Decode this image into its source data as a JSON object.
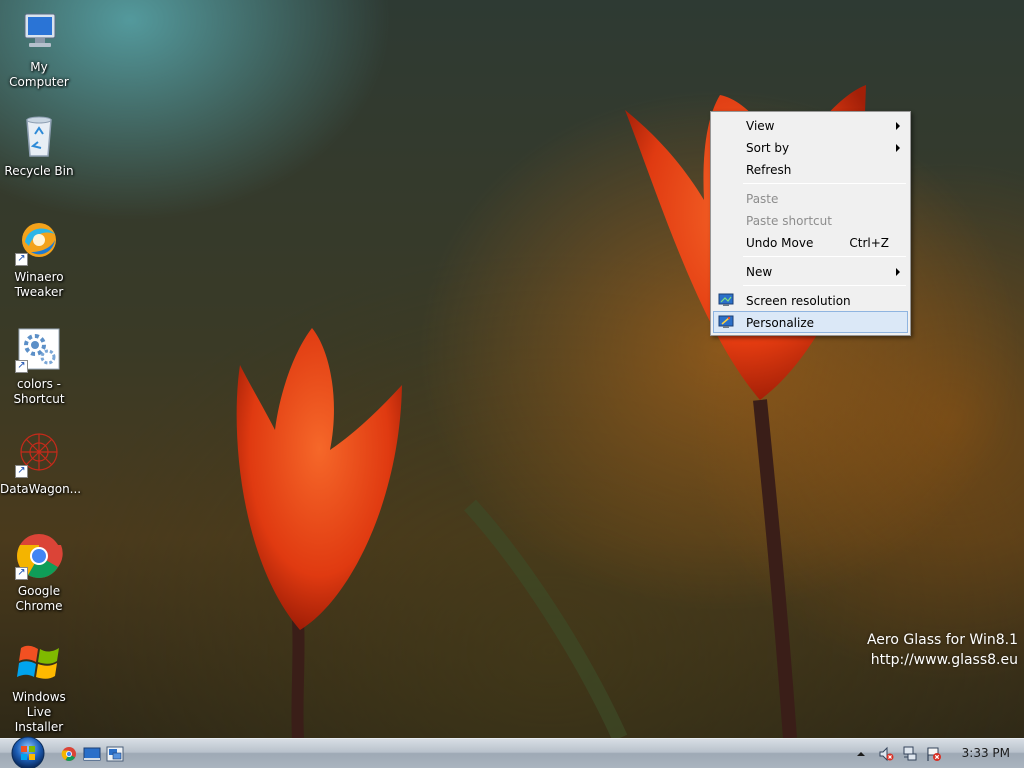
{
  "desktop_icons": [
    {
      "label": "My Computer",
      "icon": "computer-icon"
    },
    {
      "label": "Recycle Bin",
      "icon": "recycle-bin-icon"
    },
    {
      "label": "Winaero\nTweaker",
      "icon": "winaero-tweaker-icon",
      "shortcut": true
    },
    {
      "label": "colors -\nShortcut",
      "icon": "colors-settings-icon",
      "shortcut": true
    },
    {
      "label": "DataWagon...",
      "icon": "datawagon-icon",
      "shortcut": true
    },
    {
      "label": "Google\nChrome",
      "icon": "chrome-icon",
      "shortcut": true
    },
    {
      "label": "Windows Live\nInstaller",
      "icon": "windows-logo-icon"
    }
  ],
  "context_menu": {
    "view": "View",
    "sort_by": "Sort by",
    "refresh": "Refresh",
    "paste": "Paste",
    "paste_shortcut": "Paste shortcut",
    "undo_move": "Undo Move",
    "undo_move_shortcut": "Ctrl+Z",
    "new": "New",
    "screen_resolution": "Screen resolution",
    "personalize": "Personalize"
  },
  "watermark": {
    "line1": "Aero Glass for Win8.1",
    "line2": "http://www.glass8.eu"
  },
  "taskbar": {
    "clock": "3:33 PM"
  },
  "colors": {
    "menu_highlight": "#dbe8f7",
    "menu_highlight_border": "#8fb4e0",
    "taskbar": "#b9c2cc"
  }
}
